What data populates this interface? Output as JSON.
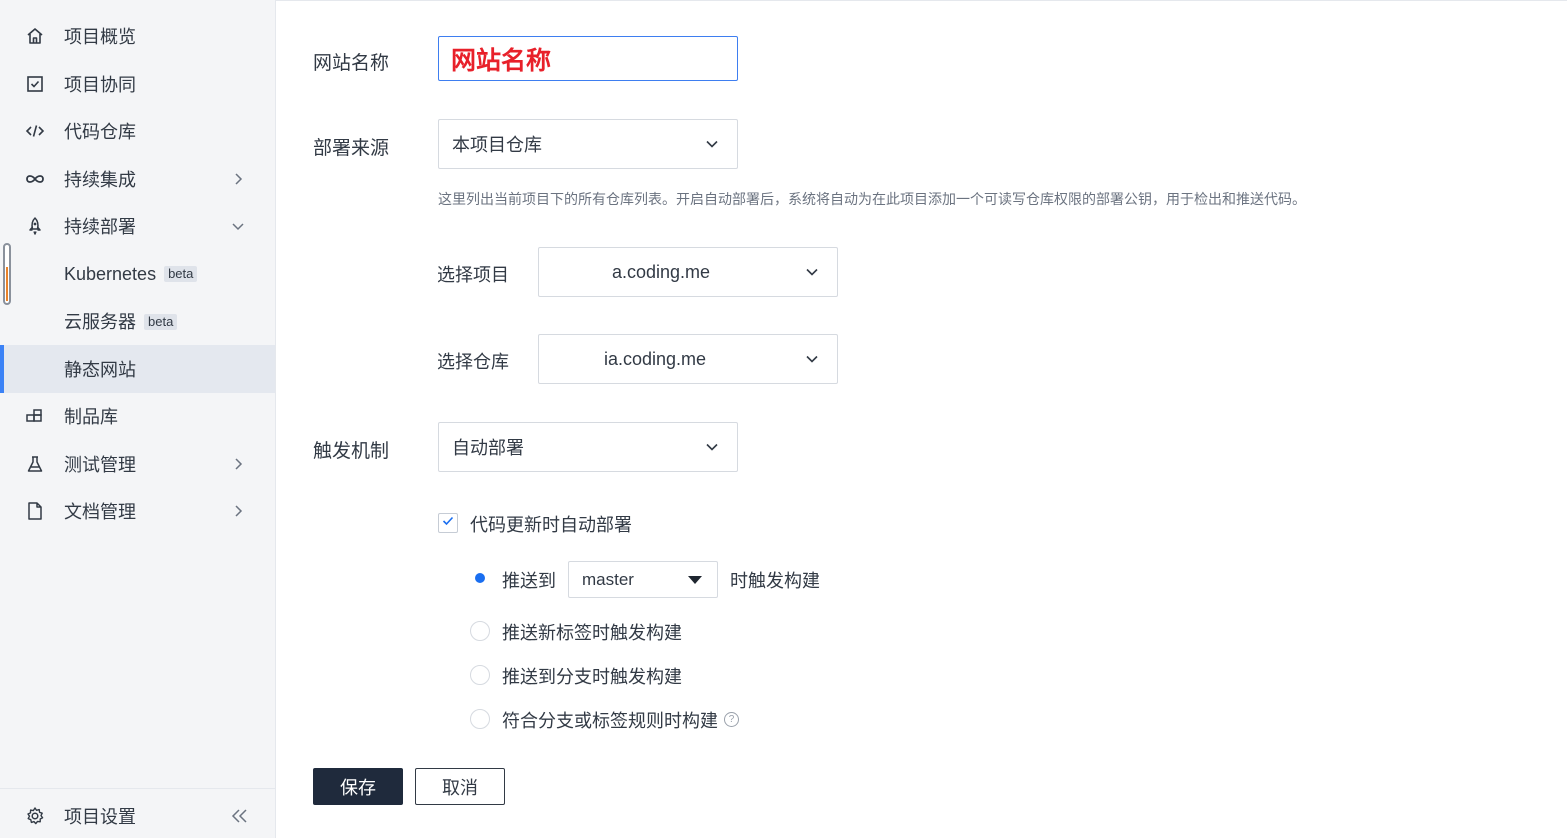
{
  "sidebar": {
    "items": [
      {
        "label": "项目概览",
        "icon": "home-icon"
      },
      {
        "label": "项目协同",
        "icon": "checkbox-icon"
      },
      {
        "label": "代码仓库",
        "icon": "code-icon"
      },
      {
        "label": "持续集成",
        "icon": "infinity-icon",
        "chevron": "right"
      },
      {
        "label": "持续部署",
        "icon": "rocket-icon",
        "chevron": "down"
      },
      {
        "label": "Kubernetes",
        "badge": "beta"
      },
      {
        "label": "云服务器",
        "badge": "beta"
      },
      {
        "label": "静态网站",
        "active": true
      },
      {
        "label": "制品库",
        "icon": "package-icon"
      },
      {
        "label": "测试管理",
        "icon": "flask-icon",
        "chevron": "right"
      },
      {
        "label": "文档管理",
        "icon": "document-icon",
        "chevron": "right"
      }
    ],
    "settings": {
      "label": "项目设置",
      "icon": "gear-icon"
    },
    "collapse_icon": "double-chevron-left-icon"
  },
  "form": {
    "site_name": {
      "label": "网站名称",
      "value": "网站名称"
    },
    "source": {
      "label": "部署来源",
      "value": "本项目仓库",
      "hint": "这里列出当前项目下的所有仓库列表。开启自动部署后，系统将自动为在此项目添加一个可读写仓库权限的部署公钥，用于检出和推送代码。"
    },
    "project": {
      "label": "选择项目",
      "value": "a.coding.me"
    },
    "repo": {
      "label": "选择仓库",
      "value": "ia.coding.me"
    },
    "trigger": {
      "label": "触发机制",
      "value": "自动部署"
    },
    "auto_deploy": {
      "label": "代码更新时自动部署",
      "checked": true
    },
    "radios": {
      "push_to": {
        "label": "推送到",
        "suffix": "时触发构建",
        "branch": "master",
        "checked": true
      },
      "new_tag": {
        "label": "推送新标签时触发构建"
      },
      "branch": {
        "label": "推送到分支时触发构建"
      },
      "rule": {
        "label": "符合分支或标签规则时构建",
        "help": "?"
      }
    }
  },
  "buttons": {
    "save": "保存",
    "cancel": "取消"
  },
  "colors": {
    "accent": "#3b82f6",
    "save_bg": "#1f2a3c",
    "site_name_text": "#e8202a",
    "radio_selected": "#1a6ef0"
  }
}
